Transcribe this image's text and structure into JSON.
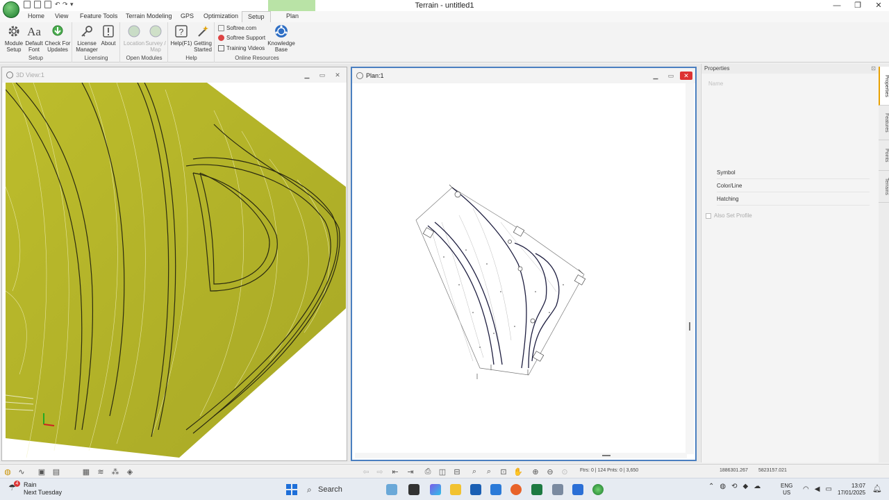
{
  "app": {
    "title": "Terrain - untitled1",
    "context_tab": "Plan"
  },
  "tabs": [
    "Home",
    "View",
    "Feature Tools",
    "Terrain Modeling",
    "GPS",
    "Optimization",
    "Setup"
  ],
  "active_tab": "Setup",
  "ribbon": {
    "setup": {
      "label": "Setup",
      "buttons": [
        {
          "label": "Module Setup",
          "icon": "gear-icon"
        },
        {
          "label": "Default Font",
          "icon": "font-icon"
        },
        {
          "label": "Check For Updates",
          "icon": "update-icon"
        }
      ]
    },
    "licensing": {
      "label": "Licensing",
      "buttons": [
        {
          "label": "License Manager",
          "icon": "key-icon"
        },
        {
          "label": "About",
          "icon": "info-icon"
        }
      ]
    },
    "open_modules": {
      "label": "Open Modules",
      "buttons": [
        {
          "label": "Location",
          "icon": "globe-icon"
        },
        {
          "label": "Survey / Map",
          "icon": "globe-icon"
        }
      ]
    },
    "help": {
      "label": "Help",
      "buttons": [
        {
          "label": "Help(F1)",
          "icon": "help-icon"
        },
        {
          "label": "Getting Started",
          "icon": "wand-icon"
        }
      ]
    },
    "online": {
      "label": "Online Resources",
      "links": [
        "Softree.com",
        "Softree Support",
        "Training Videos"
      ],
      "knowledge_base": "Knowledge Base"
    }
  },
  "view3d": {
    "title": "3D View:1"
  },
  "plan": {
    "title": "Plan:1"
  },
  "properties": {
    "title": "Properties",
    "name_label": "Name",
    "rows": [
      "Symbol",
      "Color/Line",
      "Hatching"
    ],
    "also_set_profile": "Also Set Profile"
  },
  "vtabs": [
    "Properties",
    "Features",
    "Points",
    "Terrains"
  ],
  "status": {
    "counts": "Ftrs: 0 | 124  Pnts: 0 | 3,650",
    "easting": "1886301.267",
    "northing": "5823157.021"
  },
  "taskbar": {
    "weather_badge": "4",
    "weather_title": "Rain",
    "weather_sub": "Next Tuesday",
    "search": "Search",
    "lang_top": "ENG",
    "lang_bottom": "US",
    "time": "13:07",
    "date": "17/01/2025"
  },
  "colors": {
    "terrain": "#b5b52a",
    "accent": "#4a7fc0",
    "start": "#1e6fd9"
  }
}
